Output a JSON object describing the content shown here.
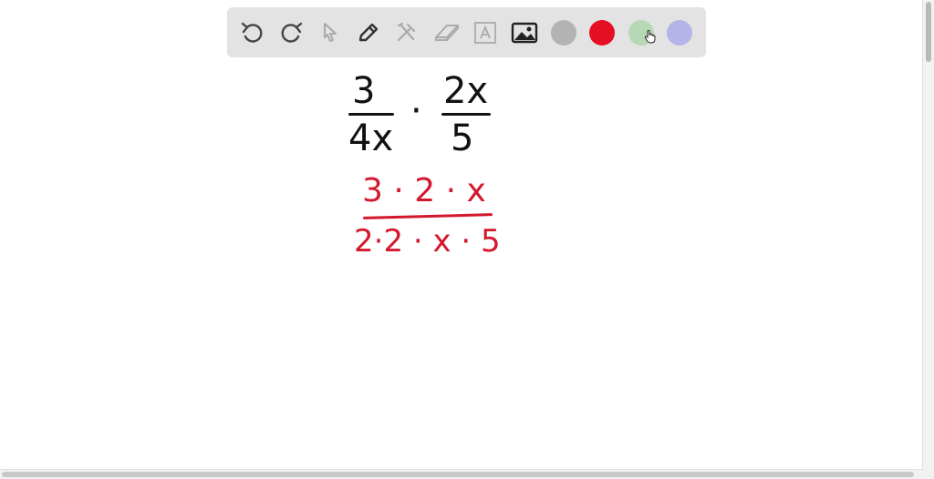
{
  "toolbar": {
    "tools": [
      "undo-icon",
      "redo-icon",
      "select-pointer-icon",
      "pen-icon",
      "tools-icon",
      "eraser-icon",
      "text-icon",
      "image-icon"
    ],
    "colors": [
      "#b3b3b3",
      "#e50f23",
      "#b7d8b5",
      "#b4b4e8"
    ]
  },
  "canvas": {
    "expr": {
      "frac1_num": "3",
      "frac1_den": "4x",
      "dot": "·",
      "frac2_num": "2x",
      "frac2_den": "5"
    },
    "step": {
      "num": "3 · 2 · x",
      "den": "2·2 · x · 5"
    },
    "ink_colors": {
      "black": "#111111",
      "red": "#d3182d"
    }
  }
}
